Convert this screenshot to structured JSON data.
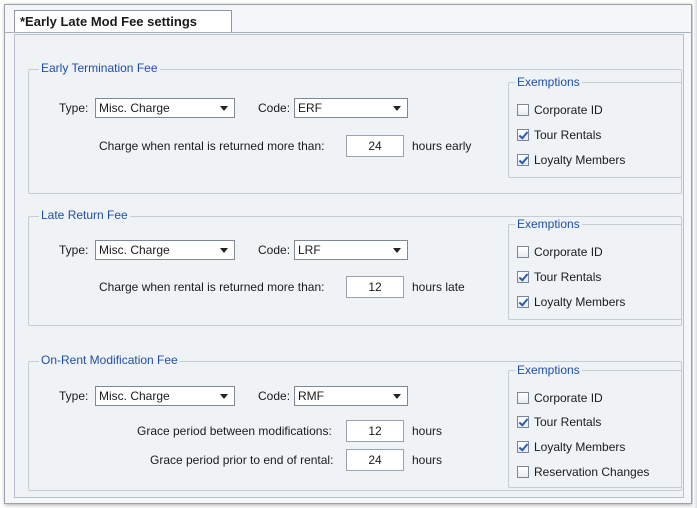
{
  "tab": {
    "label": "*Early Late Mod Fee settings"
  },
  "early": {
    "title": "Early Termination Fee",
    "type_label": "Type:",
    "type_value": "Misc. Charge",
    "code_label": "Code:",
    "code_value": "ERF",
    "charge_label": "Charge when rental is returned more than:",
    "hours_value": "24",
    "suffix": "hours early",
    "exemptions_title": "Exemptions",
    "exemptions": [
      {
        "label": "Corporate ID",
        "checked": false
      },
      {
        "label": "Tour Rentals",
        "checked": true
      },
      {
        "label": "Loyalty Members",
        "checked": true
      }
    ]
  },
  "late": {
    "title": "Late Return Fee",
    "type_label": "Type:",
    "type_value": "Misc. Charge",
    "code_label": "Code:",
    "code_value": "LRF",
    "charge_label": "Charge when rental is returned more than:",
    "hours_value": "12",
    "suffix": "hours late",
    "exemptions_title": "Exemptions",
    "exemptions": [
      {
        "label": "Corporate ID",
        "checked": false
      },
      {
        "label": "Tour Rentals",
        "checked": true
      },
      {
        "label": "Loyalty Members",
        "checked": true
      }
    ]
  },
  "mod": {
    "title": "On-Rent Modification Fee",
    "type_label": "Type:",
    "type_value": "Misc. Charge",
    "code_label": "Code:",
    "code_value": "RMF",
    "grace_mod_label": "Grace period between modifications:",
    "grace_mod_value": "12",
    "grace_mod_suffix": "hours",
    "grace_end_label": "Grace period prior to end of rental:",
    "grace_end_value": "24",
    "grace_end_suffix": "hours",
    "exemptions_title": "Exemptions",
    "exemptions": [
      {
        "label": "Corporate ID",
        "checked": false
      },
      {
        "label": "Tour Rentals",
        "checked": true
      },
      {
        "label": "Loyalty Members",
        "checked": true
      },
      {
        "label": "Reservation Changes",
        "checked": false
      }
    ]
  }
}
